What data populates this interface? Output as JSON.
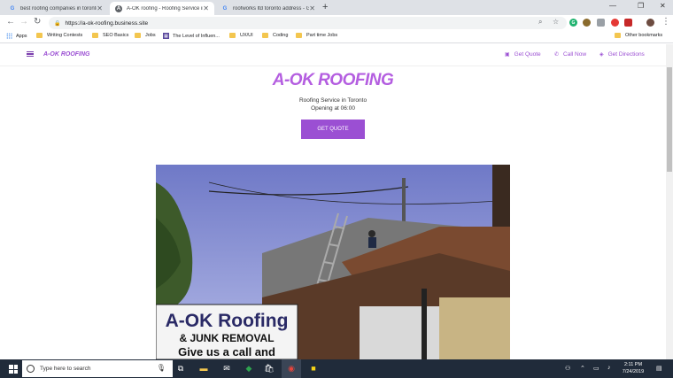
{
  "browser": {
    "tabs": [
      {
        "title": "best roofing companies in toronto",
        "favicon": "G",
        "active": false
      },
      {
        "title": "A-OK roofing - Roofing Service in Toronto",
        "favicon": "A",
        "active": true
      },
      {
        "title": "roofworks ltd toronto address - Google",
        "favicon": "G",
        "active": false
      }
    ],
    "new_tab": "+",
    "url": "https://a-ok-roofing.business.site",
    "bookmarks": [
      {
        "label": "Apps",
        "type": "apps"
      },
      {
        "label": "Writing Contests",
        "type": "folder"
      },
      {
        "label": "SEO Basics",
        "type": "folder"
      },
      {
        "label": "Jobs",
        "type": "folder"
      },
      {
        "label": "The Level of Influen...",
        "type": "site"
      },
      {
        "label": "UX/UI",
        "type": "folder"
      },
      {
        "label": "Coding",
        "type": "folder"
      },
      {
        "label": "Part time Jobs",
        "type": "folder"
      }
    ],
    "other_bookmarks": "Other bookmarks"
  },
  "site": {
    "brand": "A-OK ROOFING",
    "nav": {
      "quote": "Get Quote",
      "call": "Call Now",
      "directions": "Get Directions"
    },
    "hero": {
      "title": "A-OK ROOFING",
      "subtitle": "Roofing Service in Toronto",
      "hours": "Opening at 06:00",
      "cta": "GET QUOTE"
    },
    "sign": {
      "line1": "A-OK Roofing",
      "line2": "& JUNK REMOVAL",
      "line3": "Give us a call and"
    },
    "accent_color": "#9b4fd3"
  },
  "taskbar": {
    "search_placeholder": "Type here to search",
    "time": "2:11 PM",
    "date": "7/24/2019"
  }
}
